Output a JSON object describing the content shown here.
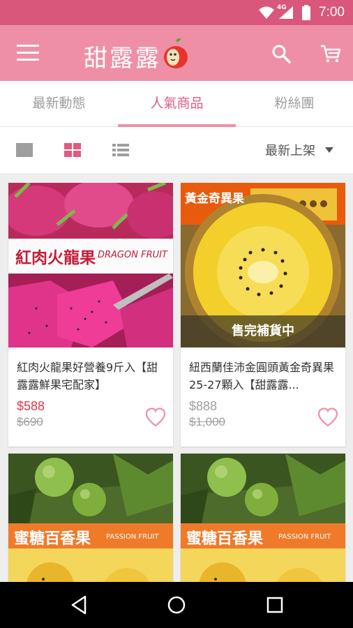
{
  "status": {
    "time": "7:00",
    "network": "4G"
  },
  "app": {
    "brand": "甜露露"
  },
  "tabs": [
    {
      "label": "最新動態"
    },
    {
      "label": "人氣商品"
    },
    {
      "label": "粉絲團"
    }
  ],
  "toolbar": {
    "sort_label": "最新上架"
  },
  "products": [
    {
      "title": "紅肉火龍果好營養9斤入【甜露露鮮果宅配家】",
      "price": "$588",
      "original_price": "$690",
      "banner": "紅肉火龍果",
      "banner_en": "DRAGON FRUIT"
    },
    {
      "title": "紐西蘭佳沛金圓頭黃金奇異果25-27顆入【甜露露...",
      "price": "$888",
      "original_price": "$1,000",
      "banner": "黃金奇異果",
      "status": "售完補貨中"
    },
    {
      "banner": "蜜糖百香果",
      "banner_en": "PASSION FRUIT"
    },
    {
      "banner": "蜜糖百香果",
      "banner_en": "PASSION FRUIT"
    }
  ],
  "colors": {
    "primary": "#ef8fa5",
    "statusbar": "#d9577a",
    "accent": "#e25a7e",
    "price": "#e5364b"
  }
}
